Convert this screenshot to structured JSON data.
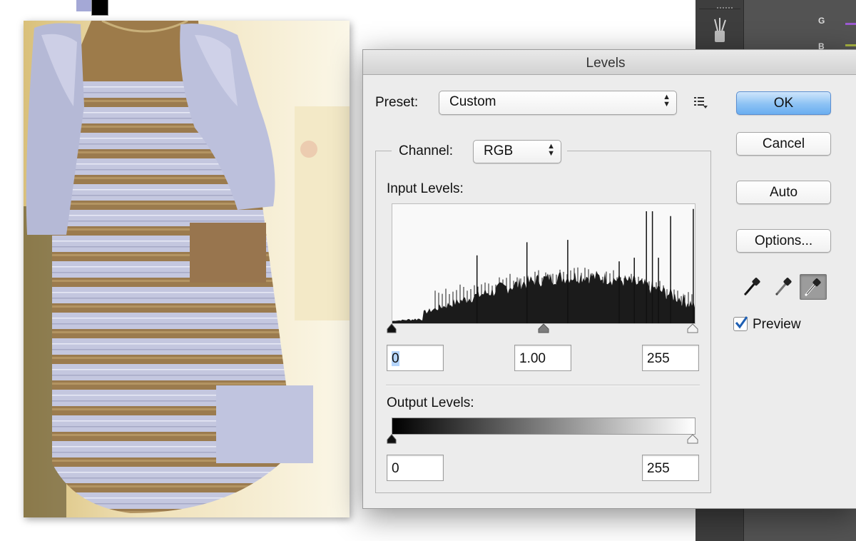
{
  "dialog": {
    "title": "Levels",
    "preset": {
      "label": "Preset:",
      "value": "Custom"
    },
    "channel": {
      "label": "Channel:",
      "value": "RGB"
    },
    "input_levels": {
      "label": "Input Levels:",
      "black": "0",
      "gamma": "1.00",
      "white": "255"
    },
    "output_levels": {
      "label": "Output Levels:",
      "black": "0",
      "white": "255"
    },
    "buttons": {
      "ok": "OK",
      "cancel": "Cancel",
      "auto": "Auto",
      "options": "Options..."
    },
    "preview": {
      "label": "Preview",
      "checked": true
    },
    "histogram_spikes": [
      {
        "x": 0.28,
        "h": 0.57
      },
      {
        "x": 0.445,
        "h": 0.68
      },
      {
        "x": 0.58,
        "h": 0.7
      },
      {
        "x": 0.75,
        "h": 0.52
      },
      {
        "x": 0.8,
        "h": 0.55
      },
      {
        "x": 0.84,
        "h": 0.94
      },
      {
        "x": 0.86,
        "h": 0.94
      },
      {
        "x": 0.88,
        "h": 0.55
      },
      {
        "x": 0.92,
        "h": 0.9
      },
      {
        "x": 0.995,
        "h": 0.96
      }
    ]
  },
  "photoshop_panel": {
    "channel_letters": [
      "G",
      "B"
    ],
    "colors": {
      "fg_swatch": "#a4a8d6",
      "g_bar": "#9b59d0",
      "b_bar": "#a8b440",
      "teal_bar": "#1bb08e"
    }
  },
  "photo": {
    "swatches": {
      "brown": "#98754e",
      "blue": "#c0c4df"
    }
  }
}
